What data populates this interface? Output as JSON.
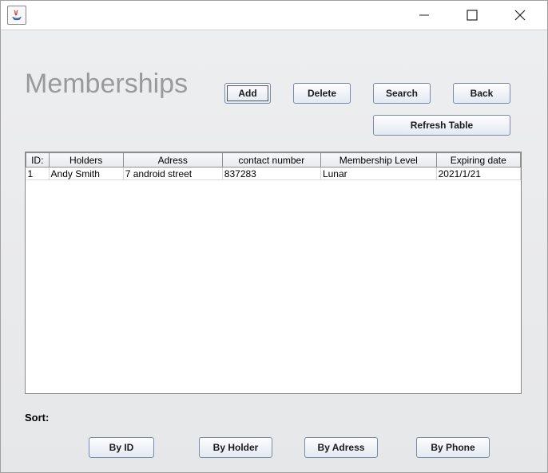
{
  "heading": "Memberships",
  "buttons": {
    "add": "Add",
    "delete": "Delete",
    "search": "Search",
    "back": "Back",
    "refresh": "Refresh Table"
  },
  "table": {
    "headers": [
      "ID:",
      "Holders",
      "Adress",
      "contact number",
      "Membership Level",
      "Expiring date"
    ],
    "rows": [
      [
        "1",
        "Andy Smith",
        "7 android street",
        "837283",
        "Lunar",
        "2021/1/21"
      ]
    ]
  },
  "sort": {
    "label": "Sort:",
    "by_id": "By ID",
    "by_holder": "By Holder",
    "by_adress": "By Adress",
    "by_phone": "By Phone"
  }
}
